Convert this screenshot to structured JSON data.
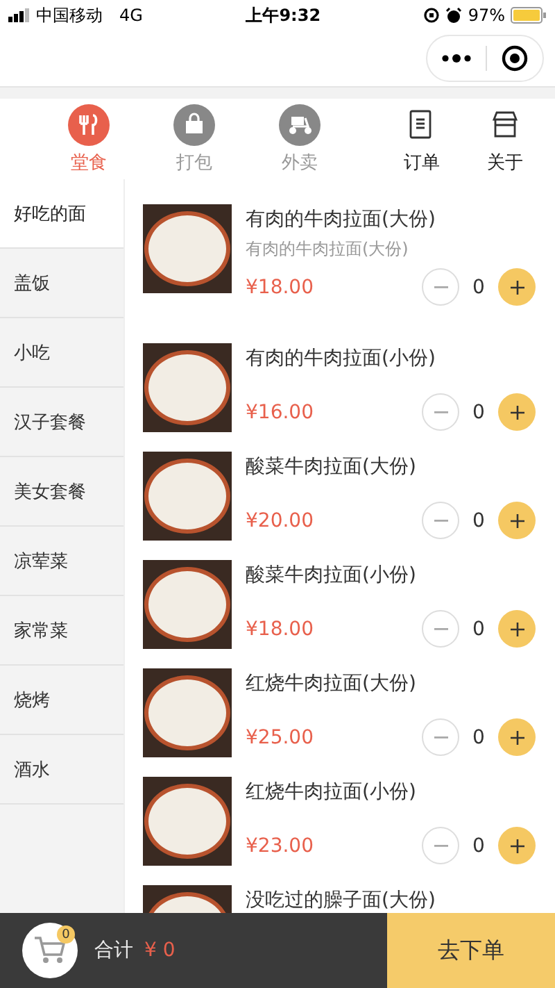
{
  "status_bar": {
    "carrier": "中国移动",
    "network": "4G",
    "time": "上午9:32",
    "battery": "97%"
  },
  "tabs": [
    {
      "label": "堂食",
      "kind": "circle",
      "selected": true
    },
    {
      "label": "打包",
      "kind": "circle",
      "selected": false
    },
    {
      "label": "外卖",
      "kind": "circle",
      "selected": false
    },
    {
      "label": "订单",
      "kind": "outline",
      "selected": false
    },
    {
      "label": "关于",
      "kind": "outline",
      "selected": false
    }
  ],
  "sidebar": {
    "items": [
      {
        "label": "好吃的面",
        "selected": true
      },
      {
        "label": "盖饭",
        "selected": false
      },
      {
        "label": "小吃",
        "selected": false
      },
      {
        "label": "汉子套餐",
        "selected": false
      },
      {
        "label": "美女套餐",
        "selected": false
      },
      {
        "label": "凉荤菜",
        "selected": false
      },
      {
        "label": "家常菜",
        "selected": false
      },
      {
        "label": "烧烤",
        "selected": false
      },
      {
        "label": "酒水",
        "selected": false
      }
    ]
  },
  "dishes": [
    {
      "name": "有肉的牛肉拉面(大份)",
      "description": "有肉的牛肉拉面(大份)",
      "price": "¥18.00",
      "quantity": "0"
    },
    {
      "name": "有肉的牛肉拉面(小份)",
      "price": "¥16.00",
      "quantity": "0"
    },
    {
      "name": "酸菜牛肉拉面(大份)",
      "price": "¥20.00",
      "quantity": "0"
    },
    {
      "name": "酸菜牛肉拉面(小份)",
      "price": "¥18.00",
      "quantity": "0"
    },
    {
      "name": "红烧牛肉拉面(大份)",
      "price": "¥25.00",
      "quantity": "0"
    },
    {
      "name": "红烧牛肉拉面(小份)",
      "price": "¥23.00",
      "quantity": "0"
    },
    {
      "name": "没吃过的臊子面(大份)"
    }
  ],
  "cart": {
    "badge": "0",
    "total_label": "合计",
    "total": "¥ 0",
    "checkout": "去下单"
  }
}
